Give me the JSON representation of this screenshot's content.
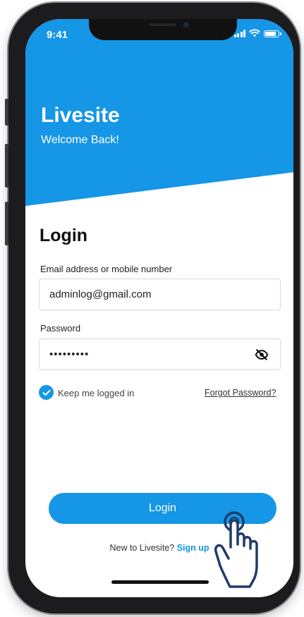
{
  "status_bar": {
    "time": "9:41"
  },
  "header": {
    "app_name": "Livesite",
    "subtitle": "Welcome Back!"
  },
  "form": {
    "heading": "Login",
    "email_label": "Email address or mobile number",
    "email_value": "adminlog@gmail.com",
    "password_label": "Password",
    "password_value": "•••••••••",
    "keep_logged_in_label": "Keep me logged in",
    "keep_logged_in_checked": true,
    "forgot_password_label": "Forgot Password?",
    "login_button_label": "Login"
  },
  "footer": {
    "prompt": "New to Livesite?",
    "signup_label": "Sign up"
  },
  "colors": {
    "accent": "#1596e6"
  },
  "icons": [
    "signal-icon",
    "wifi-icon",
    "battery-icon",
    "eye-off-icon",
    "check-icon",
    "hand-pointer-icon"
  ]
}
